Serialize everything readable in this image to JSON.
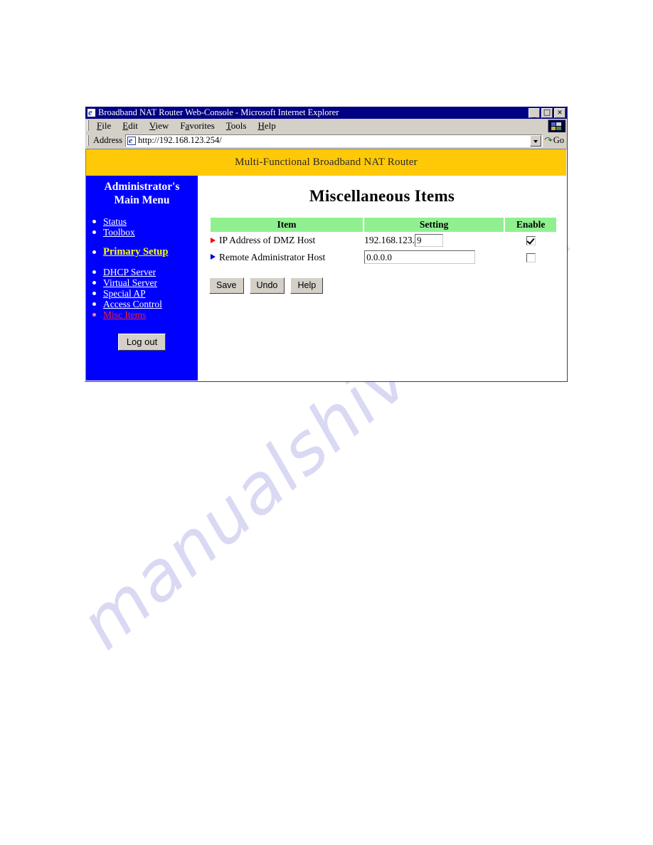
{
  "watermark": {
    "text": "manualshive.com"
  },
  "window": {
    "title": "Broadband NAT Router Web-Console - Microsoft Internet Explorer",
    "logo_icon": "ie-logo-icon",
    "controls": {
      "minimize": "_",
      "maximize": "□",
      "close": "✕"
    }
  },
  "menubar": {
    "items": [
      {
        "label": "File",
        "accel": "F",
        "rest": "ile"
      },
      {
        "label": "Edit",
        "accel": "E",
        "rest": "dit"
      },
      {
        "label": "View",
        "accel": "V",
        "rest": "iew"
      },
      {
        "label": "Favorites",
        "accel": "a",
        "pre": "F",
        "rest": "vorites"
      },
      {
        "label": "Tools",
        "accel": "T",
        "rest": "ools"
      },
      {
        "label": "Help",
        "accel": "H",
        "rest": "elp"
      }
    ]
  },
  "addressbar": {
    "label": "Address",
    "url": "http://192.168.123.254/",
    "page_icon": "page-globe-icon",
    "dropdown_icon": "chevron-down-icon",
    "go_label": "Go",
    "go_icon": "go-arrow-icon"
  },
  "banner": {
    "text": "Multi-Functional Broadband NAT Router"
  },
  "sidebar": {
    "title_line1": "Administrator's",
    "title_line2": "Main Menu",
    "groups": [
      {
        "items": [
          {
            "label": "Status",
            "style": "normal"
          },
          {
            "label": "Toolbox",
            "style": "normal"
          }
        ]
      },
      {
        "items": [
          {
            "label": "Primary Setup",
            "style": "highlight"
          }
        ]
      },
      {
        "items": [
          {
            "label": "DHCP Server",
            "style": "normal"
          },
          {
            "label": "Virtual Server",
            "style": "normal"
          },
          {
            "label": "Special AP",
            "style": "normal"
          },
          {
            "label": "Access Control",
            "style": "normal"
          },
          {
            "label": "Misc Items",
            "style": "current"
          }
        ]
      }
    ],
    "logout_label": "Log out"
  },
  "main": {
    "page_title": "Miscellaneous Items",
    "table": {
      "headers": {
        "item": "Item",
        "setting": "Setting",
        "enable": "Enable"
      },
      "rows": [
        {
          "bullet_color": "#ff0000",
          "label": "IP Address of DMZ Host",
          "prefix": "192.168.123.",
          "value": "9",
          "enabled": true
        },
        {
          "bullet_color": "#0000cc",
          "label": "Remote Administrator Host",
          "prefix": "",
          "value": "0.0.0.0",
          "enabled": false
        }
      ]
    },
    "buttons": {
      "save": "Save",
      "undo": "Undo",
      "help": "Help"
    }
  }
}
